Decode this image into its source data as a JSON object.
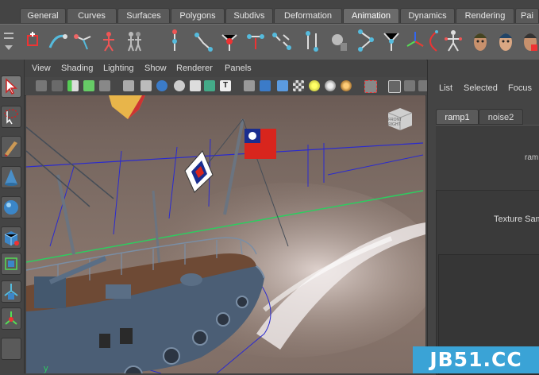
{
  "shelf_tabs": [
    "General",
    "Curves",
    "Surfaces",
    "Polygons",
    "Subdivs",
    "Deformation",
    "Animation",
    "Dynamics",
    "Rendering",
    "Pai"
  ],
  "active_tab": "Animation",
  "viewport_menu": [
    "View",
    "Shading",
    "Lighting",
    "Show",
    "Renderer",
    "Panels"
  ],
  "view_cube_label": "FRONT RIGHT",
  "axis_label": "y",
  "right_panel": {
    "menu": [
      "List",
      "Selected",
      "Focus"
    ],
    "tabs": [
      "ramp1",
      "noise2"
    ],
    "attr_label_1": "ram",
    "attr_label_2": "Texture Sam"
  },
  "watermark": "JB51.CC",
  "colors": {
    "accent": "#3aa3d6",
    "flag_red": "#d8251d",
    "flag_blue": "#1a2d8f"
  }
}
